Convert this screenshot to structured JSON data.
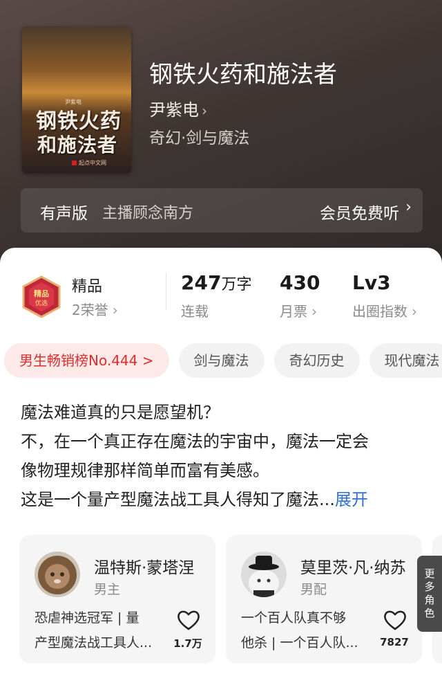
{
  "book": {
    "title": "钢铁火药和施法者",
    "author": "尹紫电",
    "genre": "奇幻·剑与魔法",
    "cover": {
      "title_line1": "钢铁火药",
      "title_line2": "和施法者",
      "author_small": "尹紫电",
      "publisher": "起点中文网"
    }
  },
  "audio": {
    "label": "有声版",
    "host": "主播顾念南方",
    "cta": "会员免费听"
  },
  "stats": {
    "quality": "精品",
    "honors": "2荣誉",
    "words": "247",
    "words_unit": "万字",
    "status": "连载",
    "monthly_tickets": "430",
    "monthly_tickets_label": "月票",
    "level": "Lv3",
    "level_label": "出圈指数"
  },
  "tags": [
    "男生畅销榜No.444 >",
    "剑与魔法",
    "奇幻历史",
    "现代魔法"
  ],
  "synopsis": {
    "lines": [
      "魔法难道真的只是愿望机？",
      "不，在一个真正存在魔法的宇宙中，魔法一定会",
      "像物理规律那样简单而富有美感。",
      "这是一个量产型魔法战工具人得知了魔法..."
    ],
    "expand": "展开"
  },
  "characters": [
    {
      "name": "温特斯·蒙塔涅",
      "role": "男主",
      "desc_line1": "恐虐神选冠军 | 量",
      "desc_line2": "产型魔法战工具人...",
      "likes": "1.7万"
    },
    {
      "name": "莫里茨·凡·纳苏",
      "role": "男配",
      "desc_line1": "一个百人队真不够",
      "desc_line2": "他杀 | 一个百人队...",
      "likes": "7827"
    }
  ],
  "more_roles": [
    "更",
    "多",
    "角",
    "色"
  ],
  "colors": {
    "header_bg": "#3e3533",
    "rank_tag": "#d9302e",
    "expand_link": "#2f6fd6"
  }
}
